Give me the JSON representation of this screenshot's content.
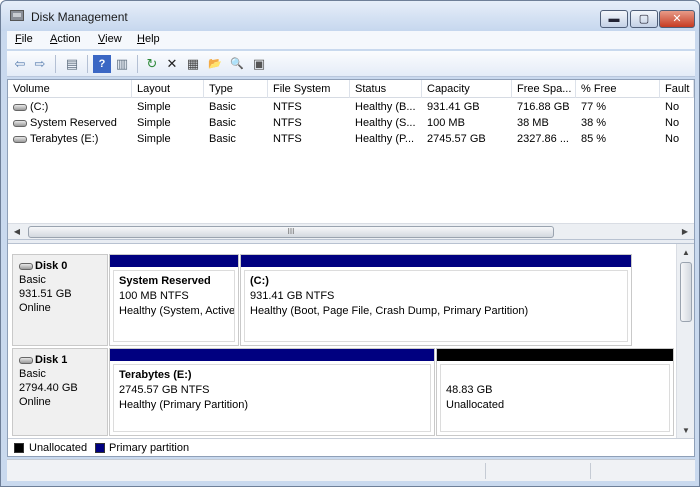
{
  "window": {
    "title": "Disk Management",
    "min": "▬",
    "max": "▢",
    "close": "✕"
  },
  "menu": [
    {
      "pre": "",
      "accel": "F",
      "post": "ile"
    },
    {
      "pre": "",
      "accel": "A",
      "post": "ction"
    },
    {
      "pre": "",
      "accel": "V",
      "post": "iew"
    },
    {
      "pre": "",
      "accel": "H",
      "post": "elp"
    }
  ],
  "toolbar": {
    "icons": [
      "back-arrow-icon",
      "forward-arrow-icon",
      "show-hide-console-tree-icon",
      "help-icon",
      "action-pane-icon",
      "refresh-icon",
      "delete-icon",
      "properties-icon",
      "open-folder-icon",
      "search-icon",
      "disk-settings-icon"
    ],
    "glyphs": [
      "⇦",
      "⇨",
      "▤",
      "?",
      "▥",
      "↻",
      "✕",
      "▦",
      "📂",
      "🔍",
      "▣"
    ]
  },
  "volume_list": {
    "columns": [
      "Volume",
      "Layout",
      "Type",
      "File System",
      "Status",
      "Capacity",
      "Free Spa...",
      "% Free",
      "Fault"
    ],
    "rows": [
      [
        "(C:)",
        "Simple",
        "Basic",
        "NTFS",
        "Healthy (B...",
        "931.41 GB",
        "716.88 GB",
        "77 %",
        "No"
      ],
      [
        "System Reserved",
        "Simple",
        "Basic",
        "NTFS",
        "Healthy (S...",
        "100 MB",
        "38 MB",
        "38 %",
        "No"
      ],
      [
        "Terabytes (E:)",
        "Simple",
        "Basic",
        "NTFS",
        "Healthy (P...",
        "2745.57 GB",
        "2327.86 ...",
        "85 %",
        "No"
      ]
    ]
  },
  "scroll": {
    "left": "◀",
    "right": "▶",
    "up": "▲",
    "down": "▼",
    "grip": "III"
  },
  "disks": [
    {
      "name": "Disk 0",
      "type": "Basic",
      "size": "931.51 GB",
      "status": "Online",
      "partitions": [
        {
          "name": "System Reserved",
          "size": "100 MB NTFS",
          "status": "Healthy (System, Active",
          "kind": "primary"
        },
        {
          "name": "(C:)",
          "size": "931.41 GB NTFS",
          "status": "Healthy (Boot, Page File, Crash Dump, Primary Partition)",
          "kind": "primary"
        }
      ]
    },
    {
      "name": "Disk 1",
      "type": "Basic",
      "size": "2794.40 GB",
      "status": "Online",
      "partitions": [
        {
          "name": "Terabytes  (E:)",
          "size": "2745.57 GB NTFS",
          "status": "Healthy (Primary Partition)",
          "kind": "primary"
        },
        {
          "name": "",
          "size": "48.83 GB",
          "status": "Unallocated",
          "kind": "unallocated"
        }
      ]
    }
  ],
  "legend": [
    {
      "label": "Unallocated",
      "color": "#000000"
    },
    {
      "label": "Primary partition",
      "color": "#000080"
    }
  ],
  "colors": {
    "primary": "#000080",
    "unallocated": "#000000"
  }
}
